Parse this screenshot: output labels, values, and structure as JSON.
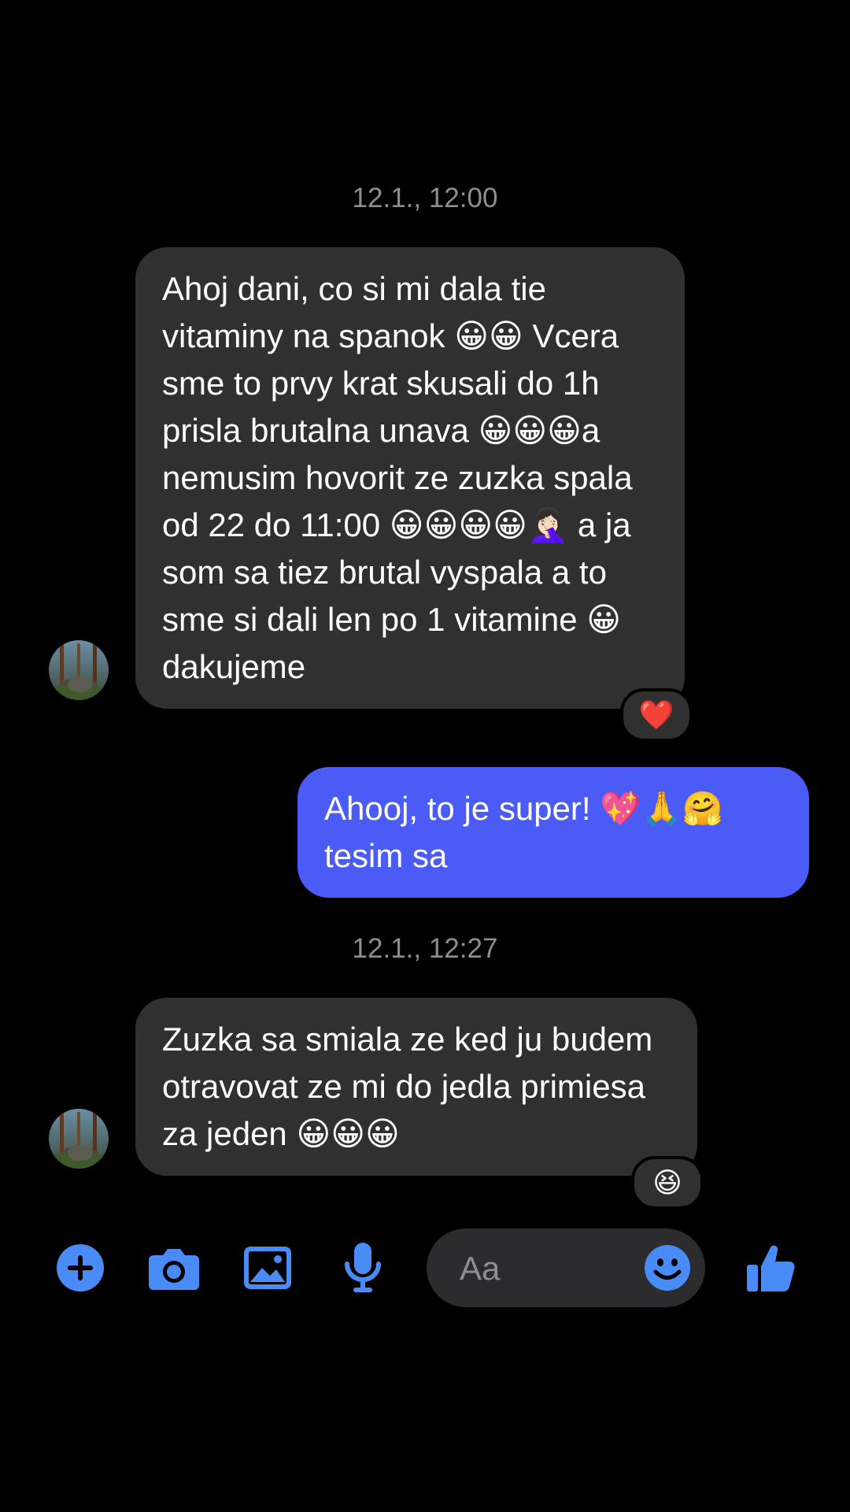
{
  "colors": {
    "background": "#000000",
    "incoming_bubble": "#303030",
    "outgoing_bubble": "#4b5cf6",
    "accent_icon": "#4a8cf7",
    "timestamp": "#8e8e93"
  },
  "conversation": {
    "timestamps": [
      "12.1., 12:00",
      "12.1., 12:27"
    ],
    "messages": [
      {
        "direction": "incoming",
        "text": "Ahoj dani, co si mi dala tie vitaminy na spanok 😀😀 Vcera sme to prvy krat skusali do 1h prisla brutalna unava 😀😀😀a nemusim hovorit ze zuzka spala od 22 do 11:00 😀😀😀😀🤦🏻‍♀️ a ja som sa tiez brutal vyspala a to sme si dali len po 1 vitamine 😀 dakujeme",
        "reaction": "❤️",
        "avatar_icon": "forest-avatar"
      },
      {
        "direction": "outgoing",
        "text": "Ahooj, to je super! 💖🙏🤗 tesim sa"
      },
      {
        "direction": "incoming",
        "text": "Zuzka sa smiala ze ked ju budem otravovat ze mi do jedla primiesa za jeden 😀😀😀",
        "reaction": "😆",
        "avatar_icon": "forest-avatar"
      }
    ]
  },
  "composer": {
    "placeholder": "Aa",
    "icons": [
      "plus-circle-icon",
      "camera-icon",
      "image-icon",
      "microphone-icon",
      "emoji-icon",
      "thumbs-up-icon"
    ]
  }
}
